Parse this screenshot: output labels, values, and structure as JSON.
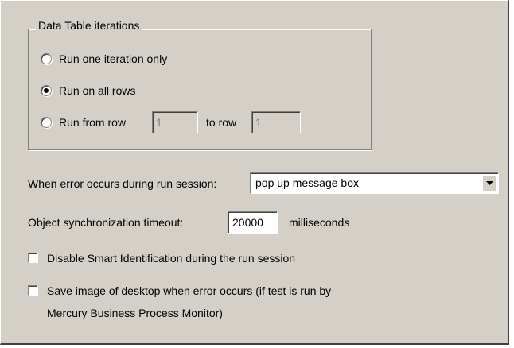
{
  "group": {
    "title": "Data Table iterations",
    "options": [
      {
        "label": "Run one iteration only",
        "selected": false
      },
      {
        "label": "Run on all rows",
        "selected": true
      },
      {
        "label": "Run from row",
        "selected": false
      }
    ],
    "from_row_value": "1",
    "to_row_label": "to row",
    "to_row_value": "1"
  },
  "error": {
    "label": "When error occurs during run session:",
    "selected": "pop up message box"
  },
  "sync": {
    "label": "Object synchronization timeout:",
    "value": "20000",
    "unit": "milliseconds"
  },
  "checkboxes": {
    "disable_smart_id": {
      "label": "Disable Smart Identification during the run session",
      "checked": false
    },
    "save_image_line1": "Save image of desktop when error occurs (if test is run by",
    "save_image_line2": "Mercury Business Process Monitor)",
    "save_image_checked": false
  },
  "colors": {
    "face": "#d4d0c8",
    "shadow": "#808080",
    "highlight": "#ffffff"
  }
}
